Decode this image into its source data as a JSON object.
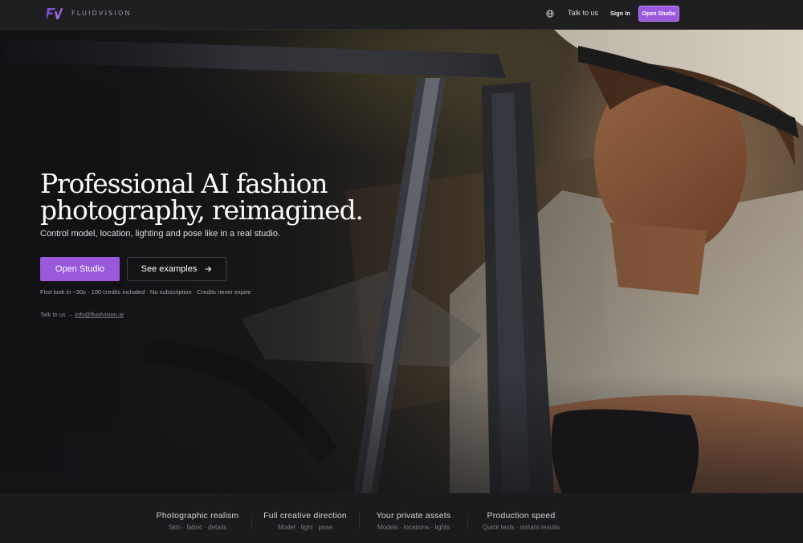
{
  "header": {
    "brand": "FLUIDVISION",
    "logo_icon": "fv-logo-icon",
    "globe_icon": "globe-icon",
    "nav_talk": "Talk to us",
    "nav_signin": "Sign In",
    "nav_open_studio": "Open Studio"
  },
  "hero": {
    "title": "Professional AI fashion photography, reimagined.",
    "subtitle": "Control model, location, lighting and pose like in a real studio.",
    "primary_button": "Open Studio",
    "secondary_button": "See examples",
    "secondary_icon": "arrow-right-icon",
    "fineprint": "First look in ~30s · 100 credits included · No subscription · Credits never expire",
    "contact_label": "Talk to us →",
    "contact_email": "info@fluidvision.ai"
  },
  "features": [
    {
      "title": "Photographic realism",
      "subtitle": "Skin · fabric · details"
    },
    {
      "title": "Full creative direction",
      "subtitle": "Model · light · pose"
    },
    {
      "title": "Your private assets",
      "subtitle": "Models · locations · lights"
    },
    {
      "title": "Production speed",
      "subtitle": "Quick tests · instant results"
    }
  ],
  "colors": {
    "accent": "#9B59E0",
    "header_bg": "#1F1F21",
    "page_bg": "#1B1B1D"
  }
}
